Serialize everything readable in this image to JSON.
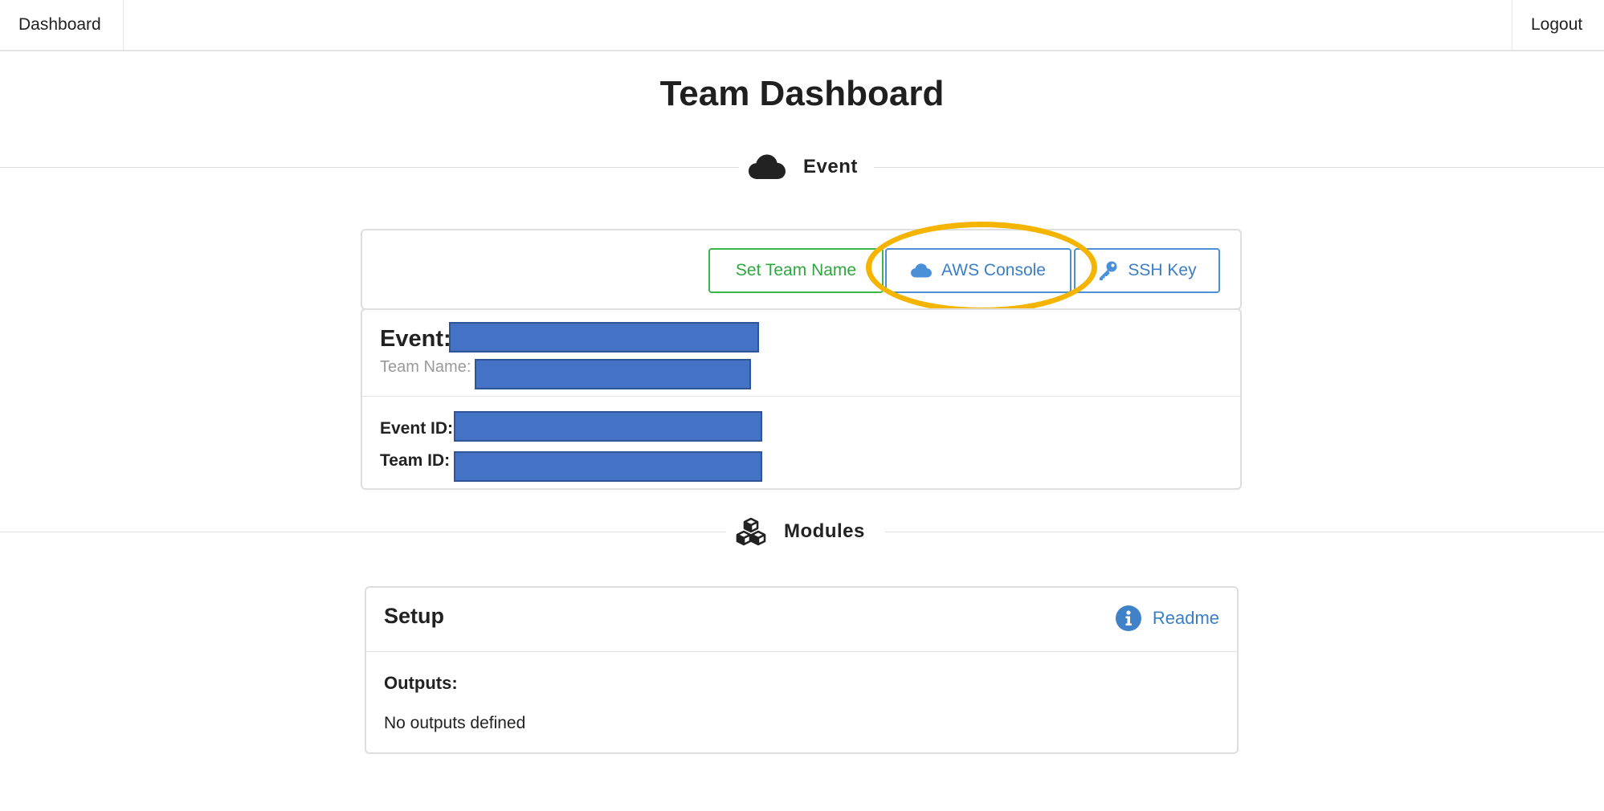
{
  "nav": {
    "dashboard_label": "Dashboard",
    "logout_label": "Logout"
  },
  "page": {
    "title": "Team Dashboard"
  },
  "sections": {
    "event": {
      "label": "Event",
      "icon": "cloud-icon"
    },
    "modules": {
      "label": "Modules",
      "icon": "cubes-icon"
    }
  },
  "toolbar": {
    "set_team_name_label": "Set Team Name",
    "aws_console_label": "AWS Console",
    "aws_console_icon": "cloud-icon",
    "ssh_key_label": "SSH Key",
    "ssh_key_icon": "key-icon"
  },
  "event_info": {
    "event_label": "Event:",
    "team_name_label": "Team Name:",
    "event_id_label": "Event ID:",
    "team_id_label": "Team ID:"
  },
  "setup_module": {
    "title": "Setup",
    "readme_label": "Readme",
    "readme_icon": "info-icon",
    "outputs_label": "Outputs:",
    "outputs_empty": "No outputs defined"
  },
  "colors": {
    "success": "#3cb64a",
    "primary": "#3a7ec6",
    "highlight": "#f5b400",
    "redaction": "#4472c4"
  }
}
